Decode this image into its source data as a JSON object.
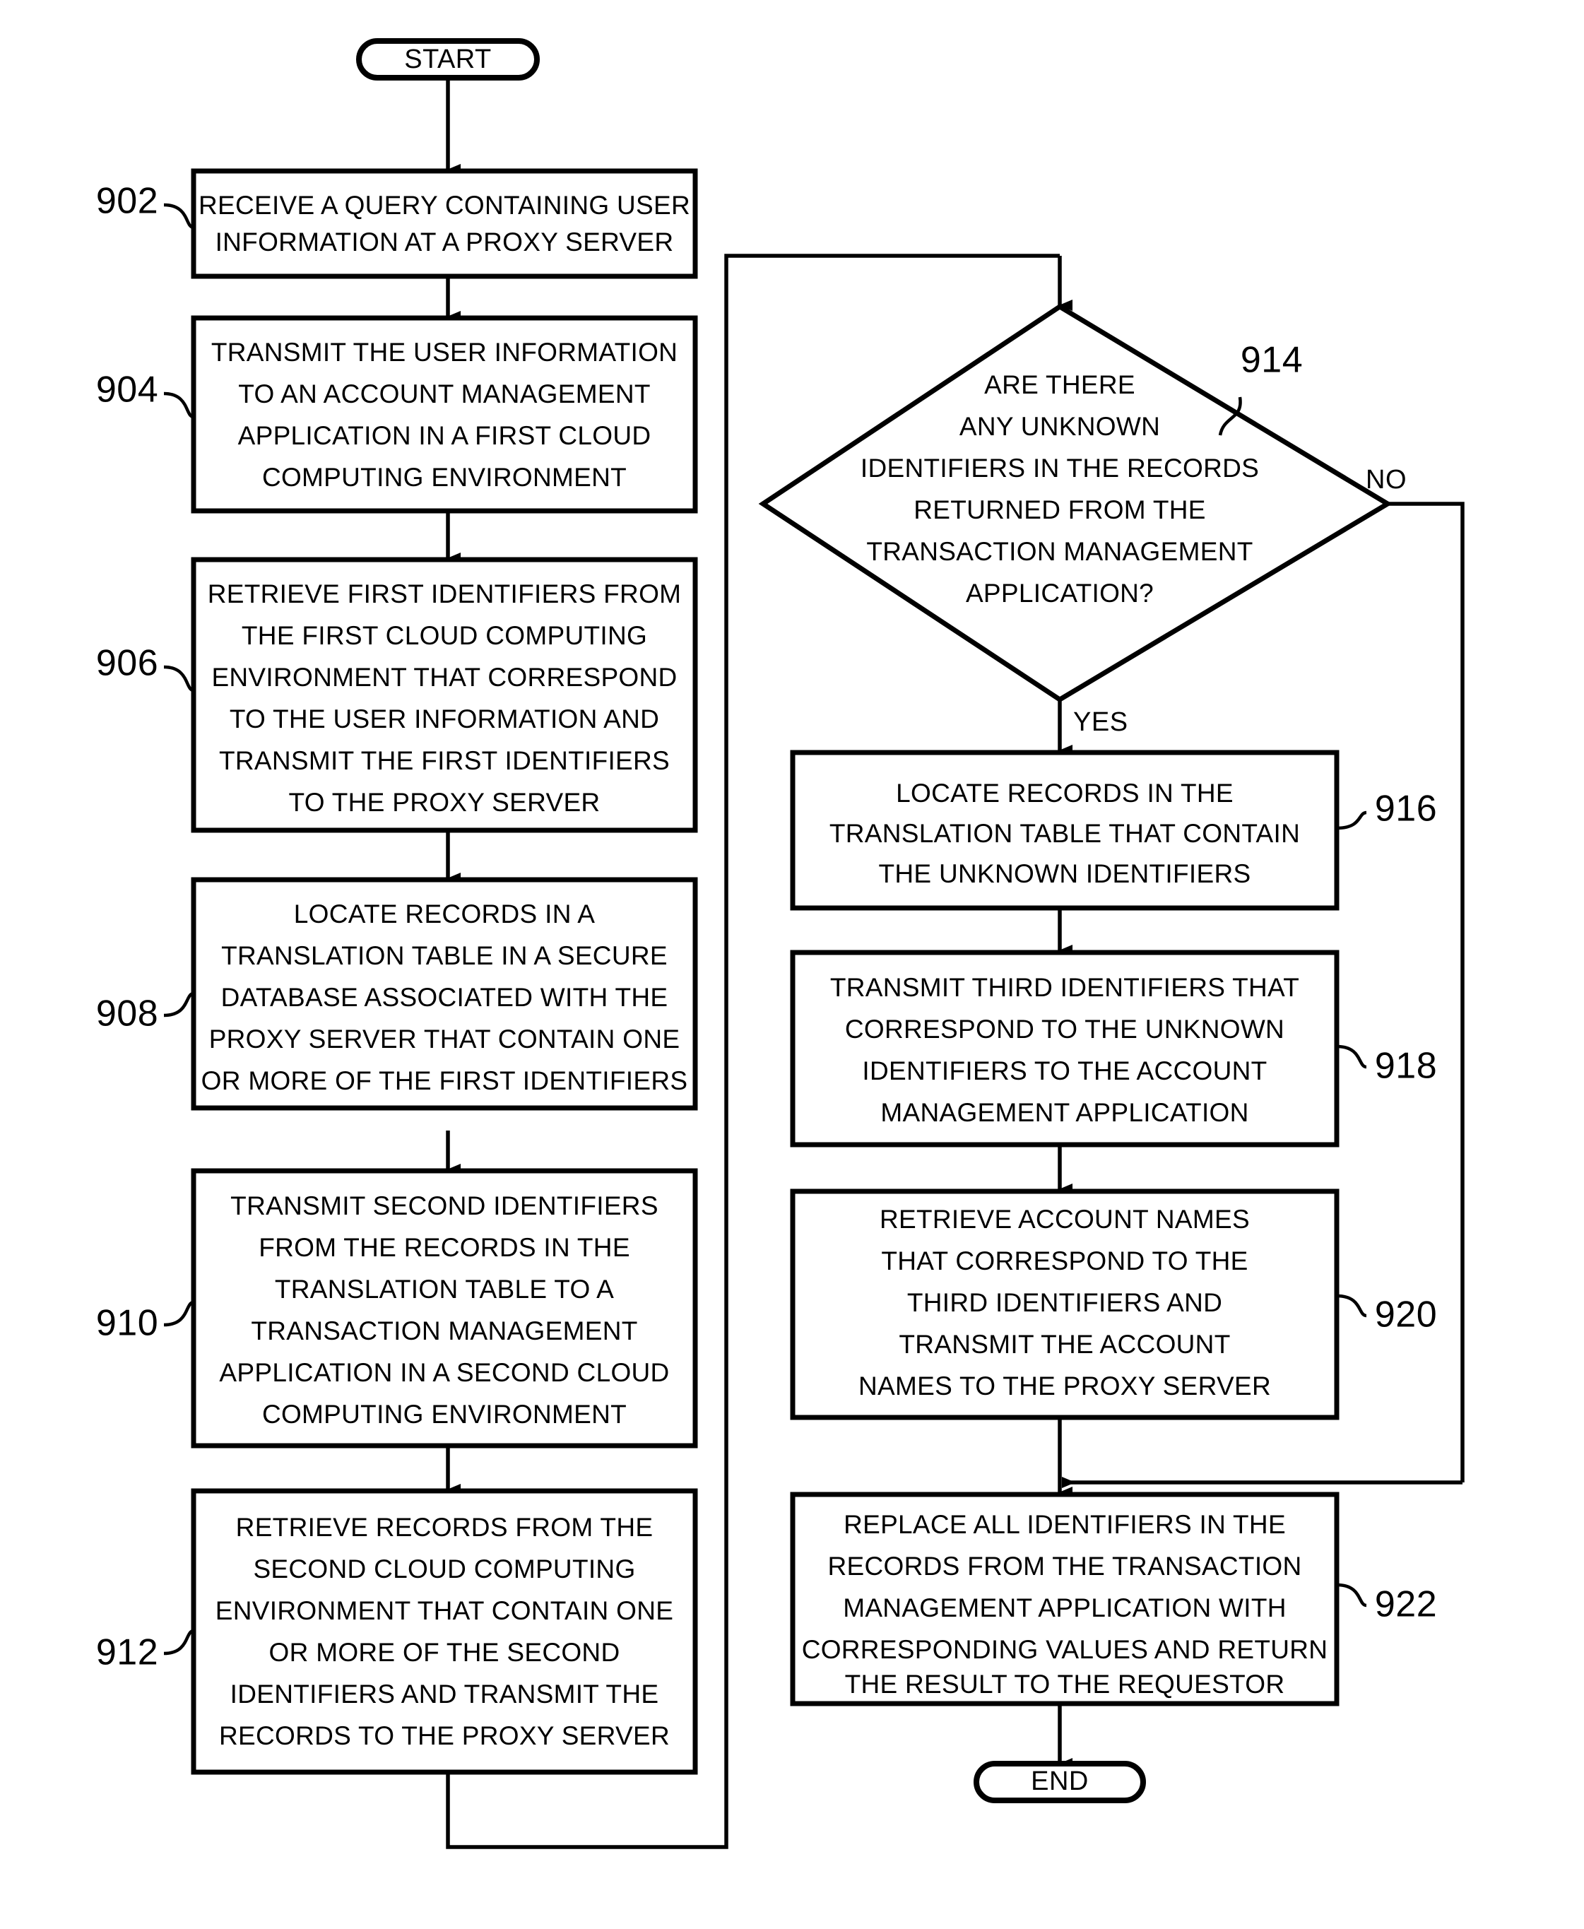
{
  "figure": {
    "type": "patent-flowchart",
    "terminals": {
      "start": "START",
      "end": "END"
    },
    "branch_labels": {
      "yes": "YES",
      "no": "NO"
    },
    "steps": [
      {
        "ref": "902",
        "shape": "process",
        "lines": [
          "RECEIVE A QUERY CONTAINING USER",
          "INFORMATION AT A PROXY SERVER"
        ]
      },
      {
        "ref": "904",
        "shape": "process",
        "lines": [
          "TRANSMIT THE USER INFORMATION",
          "TO AN ACCOUNT MANAGEMENT",
          "APPLICATION IN A FIRST CLOUD",
          "COMPUTING ENVIRONMENT"
        ]
      },
      {
        "ref": "906",
        "shape": "process",
        "lines": [
          "RETRIEVE FIRST IDENTIFIERS FROM",
          "THE FIRST CLOUD COMPUTING",
          "ENVIRONMENT THAT CORRESPOND",
          "TO THE USER INFORMATION AND",
          "TRANSMIT THE FIRST IDENTIFIERS",
          "TO THE PROXY SERVER"
        ]
      },
      {
        "ref": "908",
        "shape": "process",
        "lines": [
          "LOCATE RECORDS IN A",
          "TRANSLATION TABLE IN A SECURE",
          "DATABASE ASSOCIATED WITH THE",
          "PROXY SERVER THAT CONTAIN ONE",
          "OR MORE OF THE FIRST IDENTIFIERS"
        ]
      },
      {
        "ref": "910",
        "shape": "process",
        "lines": [
          "TRANSMIT SECOND IDENTIFIERS",
          "FROM THE RECORDS IN THE",
          "TRANSLATION TABLE TO A",
          "TRANSACTION MANAGEMENT",
          "APPLICATION IN A SECOND CLOUD",
          "COMPUTING ENVIRONMENT"
        ]
      },
      {
        "ref": "912",
        "shape": "process",
        "lines": [
          "RETRIEVE RECORDS FROM THE",
          "SECOND CLOUD COMPUTING",
          "ENVIRONMENT THAT CONTAIN ONE",
          "OR MORE OF THE SECOND",
          "IDENTIFIERS AND TRANSMIT THE",
          "RECORDS TO THE PROXY SERVER"
        ]
      },
      {
        "ref": "914",
        "shape": "decision",
        "lines": [
          "ARE THERE",
          "ANY UNKNOWN",
          "IDENTIFIERS IN THE RECORDS",
          "RETURNED FROM THE",
          "TRANSACTION MANAGEMENT",
          "APPLICATION?"
        ]
      },
      {
        "ref": "916",
        "shape": "process",
        "lines": [
          "LOCATE RECORDS IN THE",
          "TRANSLATION TABLE THAT CONTAIN",
          "THE UNKNOWN IDENTIFIERS"
        ]
      },
      {
        "ref": "918",
        "shape": "process",
        "lines": [
          "TRANSMIT THIRD IDENTIFIERS THAT",
          "CORRESPOND TO THE UNKNOWN",
          "IDENTIFIERS TO THE ACCOUNT",
          "MANAGEMENT APPLICATION"
        ]
      },
      {
        "ref": "920",
        "shape": "process",
        "lines": [
          "RETRIEVE ACCOUNT NAMES",
          "THAT CORRESPOND TO THE",
          "THIRD IDENTIFIERS AND",
          "TRANSMIT THE ACCOUNT",
          "NAMES TO THE PROXY SERVER"
        ]
      },
      {
        "ref": "922",
        "shape": "process",
        "lines": [
          "REPLACE ALL IDENTIFIERS IN THE",
          "RECORDS FROM THE TRANSACTION",
          "MANAGEMENT APPLICATION WITH",
          "CORRESPONDING VALUES AND RETURN",
          "THE RESULT TO THE REQUESTOR"
        ]
      }
    ],
    "colors": {
      "ink": "#000000",
      "paper": "#ffffff"
    }
  }
}
